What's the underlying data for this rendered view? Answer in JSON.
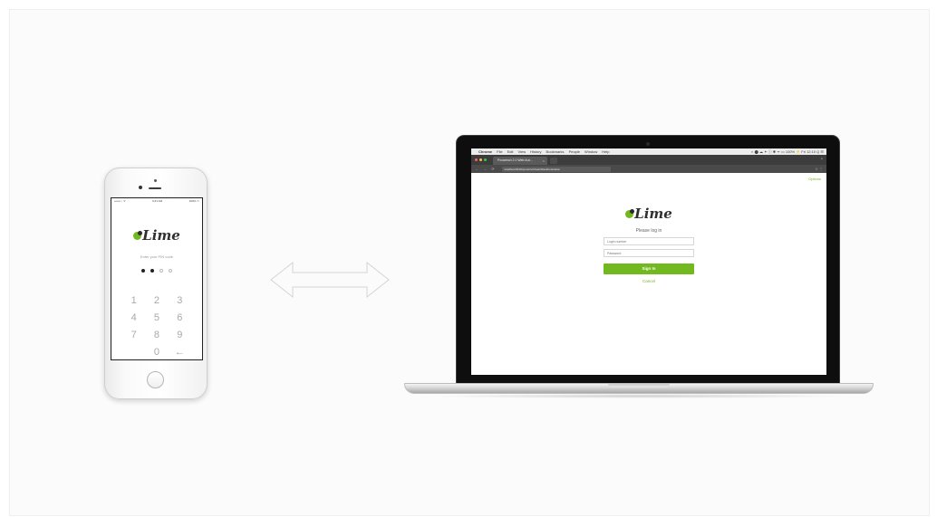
{
  "phone": {
    "status": {
      "carrier": "•••oo ○ ᯤ",
      "time": "9:41 AM",
      "battery": "100% ▭"
    },
    "logo_text": "Lime",
    "prompt": "Enter your PIN code",
    "pin_length": 4,
    "pin_filled": 2,
    "keypad": [
      "1",
      "2",
      "3",
      "4",
      "5",
      "6",
      "7",
      "8",
      "9",
      "",
      "0",
      "←"
    ]
  },
  "laptop": {
    "menubar": {
      "app": "Chrome",
      "items": [
        "File",
        "Edit",
        "View",
        "History",
        "Bookmarks",
        "People",
        "Window",
        "Help"
      ],
      "status_text": "◐ ⬤ ☁ ✦ ⓘ ✱ ᯤ ▭ 100% ⚡  Fri 12:10  Q ☰"
    },
    "tab_title": "Povarinch 2.0 Web Aut...",
    "url": "localhost:8100/povarinch/web/#/authentication",
    "options_label": "Options",
    "logo_text": "Lime",
    "subtitle": "Please log in",
    "login_placeholder": "Login number",
    "password_placeholder": "Password",
    "sign_in_label": "Sign In",
    "cancel_label": "Cancel"
  },
  "colors": {
    "accent": "#72b81f",
    "text_dark": "#2f2f2f"
  },
  "icons": [
    "lime-logo-icon",
    "apple-icon",
    "double-arrow-icon",
    "home-button-icon"
  ]
}
